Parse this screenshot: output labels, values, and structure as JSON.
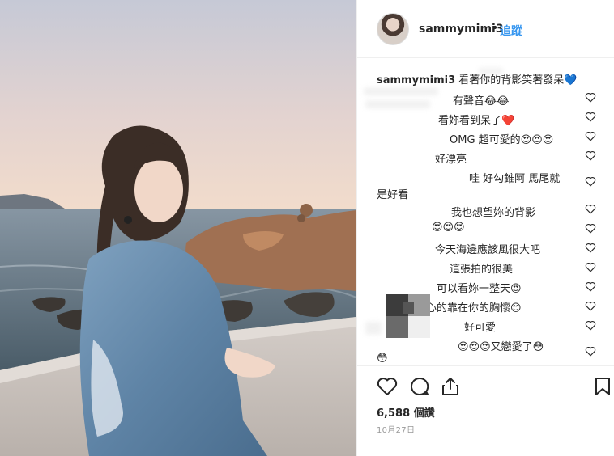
{
  "header": {
    "username": "sammymimi3",
    "separator": "•",
    "follow_label": "追蹤"
  },
  "caption": {
    "username": "sammymimi3",
    "text": "看著你的背影笑著發呆💙"
  },
  "comments": [
    {
      "text": "有聲音😂😂"
    },
    {
      "text": "看妳看到呆了❤️"
    },
    {
      "text": "OMG 超可愛的😍😍😍"
    },
    {
      "text": "好漂亮"
    },
    {
      "text": "哇 好勾錐阿 馬尾就"
    },
    {
      "text": "是好看"
    },
    {
      "text": "我也想望妳的背影"
    },
    {
      "text": "😍😍😍"
    },
    {
      "text": "今天海邊應該風很大吧"
    },
    {
      "text": "這張拍的很美"
    },
    {
      "text": "可以看妳一整天😍"
    },
    {
      "text": "安心的靠在你的胸懷😊"
    },
    {
      "text": "好可愛"
    },
    {
      "text": "😍😍😍又戀愛了😳"
    },
    {
      "text": "😳"
    }
  ],
  "actions": {
    "likes_label": "6,588 個讚",
    "date_label": "10月27日",
    "icons": [
      "heart-icon",
      "comment-icon",
      "share-icon",
      "bookmark-icon"
    ]
  },
  "colors": {
    "accent": "#3897f0",
    "text": "#262626",
    "muted": "#999999",
    "border": "#efefef"
  }
}
